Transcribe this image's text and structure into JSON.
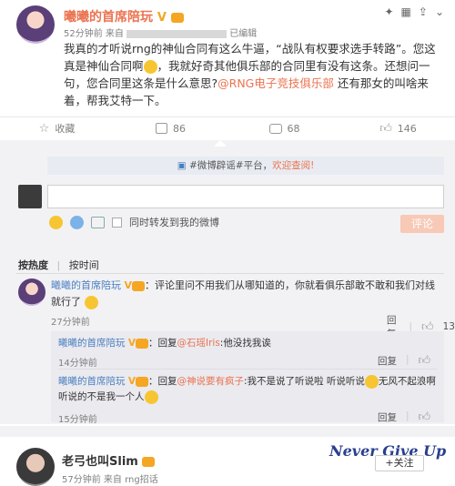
{
  "post": {
    "author": "曦曦的首席陪玩",
    "meta_time": "52分钟前",
    "meta_from": "来自",
    "meta_edited": "已编辑",
    "body_1": "我真的才听说rng的神仙合同有这么牛逼，“战队有权要求选手转路”。您这真是神仙合同啊",
    "body_2": "，我就好奇其他俱乐部的合同里有没有这条。还想问一句，您合同里这条是什么意思?",
    "mention": "@RNG电子竞技俱乐部",
    "body_3": "还有那女的叫啥来着，帮我艾特一下。",
    "actions": {
      "favorite": "收藏",
      "repost_count": "86",
      "comment_count": "68",
      "like_count": "146"
    }
  },
  "notice": {
    "prefix": "#微博辟谣#平台，",
    "link": "欢迎查阅!"
  },
  "composer": {
    "also_repost_label": "同时转发到我的微博",
    "submit_label": "评论"
  },
  "sort": {
    "by_hot": "按热度",
    "by_time": "按时间"
  },
  "comment1": {
    "author": "曦曦的首席陪玩",
    "text": "：评论里问不用我们从哪知道的，你就看俱乐部敢不敢和我们对线就行了",
    "time": "27分钟前",
    "reply_label": "回复",
    "likes": "13"
  },
  "reply1": {
    "author": "曦曦的首席陪玩",
    "reply_word": "：回复",
    "target": "@石瑶Iris",
    "text": ":他没找我诶",
    "time": "14分钟前",
    "reply_label": "回复"
  },
  "reply2": {
    "author": "曦曦的首席陪玩",
    "reply_word": "：回复",
    "target": "@神说要有疯子",
    "text_1": ":我不是说了听说啦 听说听说",
    "text_2": "无风不起浪啊 听说的不是我一个人",
    "time": "15分钟前",
    "reply_label": "回复"
  },
  "next_post": {
    "author": "老弓也叫Slim",
    "meta": "57分钟前 来自 rng招话",
    "follow_label": "+关注",
    "watermark": "Never Give Up"
  },
  "colors": {
    "accent": "#eb7350",
    "link_blue": "#4a7fbf",
    "vip_gold": "#f5a623"
  }
}
